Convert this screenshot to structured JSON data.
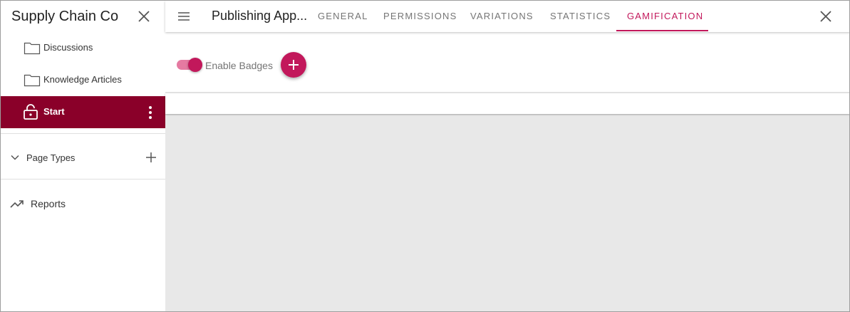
{
  "sidebar": {
    "title": "Supply Chain Co",
    "items": [
      {
        "label": "Discussions",
        "icon": "folder-icon"
      },
      {
        "label": "Knowledge Articles",
        "icon": "folder-icon"
      },
      {
        "label": "Start",
        "icon": "lock-icon",
        "active": true
      }
    ],
    "page_types_label": "Page Types",
    "reports_label": "Reports"
  },
  "header": {
    "page_title": "Publishing App...",
    "tabs": [
      {
        "label": "General"
      },
      {
        "label": "Permissions"
      },
      {
        "label": "Variations"
      },
      {
        "label": "Statistics"
      },
      {
        "label": "Gamification",
        "active": true
      }
    ]
  },
  "gamification": {
    "enable_badges_label": "Enable Badges",
    "enable_badges_on": true
  },
  "colors": {
    "accent": "#c2185b",
    "active_item_bg": "#8a0029",
    "toggle_track": "#e57aa1"
  }
}
